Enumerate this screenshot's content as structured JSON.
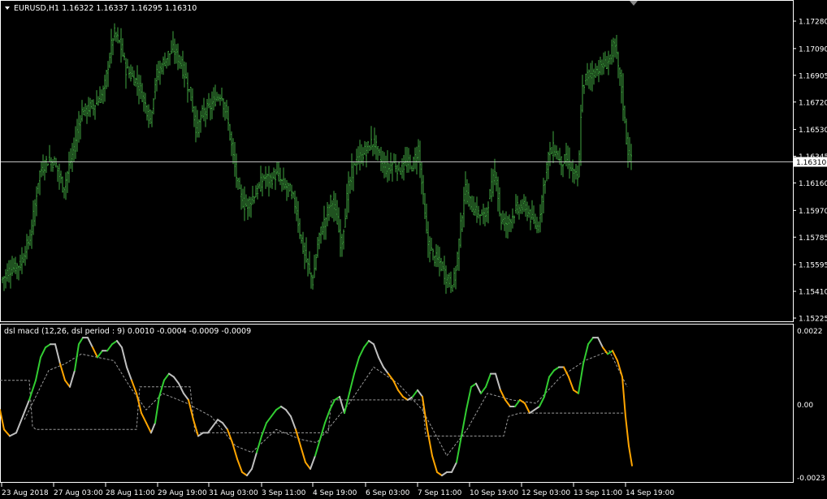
{
  "main": {
    "title": "EURUSD,H1  1.16322 1.16337 1.16295 1.16310",
    "current_price": "1.16310",
    "price_scale": [
      "1.17280",
      "1.17090",
      "1.16905",
      "1.16720",
      "1.16530",
      "1.16345",
      "1.16160",
      "1.15970",
      "1.15785",
      "1.15595",
      "1.15410",
      "1.15225"
    ]
  },
  "sub": {
    "title": "dsl macd (12,26, dsl period : 9) 0.0010 -0.0004 -0.0009 -0.0009",
    "scale_top": "0.0022",
    "scale_mid": "0.00",
    "scale_bottom": "-0.0023"
  },
  "time_axis": [
    "23 Aug 2018",
    "27 Aug 03:00",
    "28 Aug 11:00",
    "29 Aug 19:00",
    "31 Aug 03:00",
    "3 Sep 11:00",
    "4 Sep 19:00",
    "6 Sep 03:00",
    "7 Sep 11:00",
    "10 Sep 19:00",
    "12 Sep 03:00",
    "13 Sep 11:00",
    "14 Sep 19:00"
  ],
  "colors": {
    "background": "#000000",
    "bars": "#3fa53f",
    "macd_up": "#32cd32",
    "macd_neutral": "#c0c0c0",
    "macd_down": "#ffa500",
    "frame": "#ffffff",
    "signal": "#9a9a9a"
  },
  "chart_data": [
    {
      "type": "ohlc",
      "symbol": "EURUSD",
      "timeframe": "H1",
      "ylim": [
        1.15225,
        1.1737
      ],
      "current": 1.1631,
      "close_path": [
        [
          0,
          1.1548
        ],
        [
          12,
          1.1556
        ],
        [
          25,
          1.156
        ],
        [
          38,
          1.158
        ],
        [
          48,
          1.1622
        ],
        [
          58,
          1.1632
        ],
        [
          68,
          1.163
        ],
        [
          78,
          1.1612
        ],
        [
          90,
          1.1638
        ],
        [
          100,
          1.1665
        ],
        [
          110,
          1.1668
        ],
        [
          120,
          1.1672
        ],
        [
          128,
          1.168
        ],
        [
          135,
          1.1705
        ],
        [
          140,
          1.172
        ],
        [
          148,
          1.1712
        ],
        [
          155,
          1.1695
        ],
        [
          162,
          1.169
        ],
        [
          170,
          1.1685
        ],
        [
          178,
          1.1672
        ],
        [
          185,
          1.166
        ],
        [
          192,
          1.169
        ],
        [
          200,
          1.1698
        ],
        [
          207,
          1.1705
        ],
        [
          214,
          1.1708
        ],
        [
          222,
          1.17
        ],
        [
          228,
          1.169
        ],
        [
          235,
          1.1675
        ],
        [
          242,
          1.1652
        ],
        [
          250,
          1.1665
        ],
        [
          258,
          1.1668
        ],
        [
          266,
          1.1675
        ],
        [
          272,
          1.1678
        ],
        [
          280,
          1.166
        ],
        [
          288,
          1.163
        ],
        [
          295,
          1.1608
        ],
        [
          302,
          1.16
        ],
        [
          310,
          1.1605
        ],
        [
          318,
          1.1612
        ],
        [
          325,
          1.162
        ],
        [
          332,
          1.1618
        ],
        [
          340,
          1.1622
        ],
        [
          348,
          1.1615
        ],
        [
          356,
          1.1612
        ],
        [
          364,
          1.16
        ],
        [
          371,
          1.1575
        ],
        [
          378,
          1.156
        ],
        [
          385,
          1.1548
        ],
        [
          392,
          1.1578
        ],
        [
          400,
          1.159
        ],
        [
          408,
          1.1605
        ],
        [
          415,
          1.159
        ],
        [
          420,
          1.1572
        ],
        [
          428,
          1.161
        ],
        [
          436,
          1.163
        ],
        [
          445,
          1.1635
        ],
        [
          452,
          1.164
        ],
        [
          460,
          1.1645
        ],
        [
          468,
          1.1632
        ],
        [
          476,
          1.1625
        ],
        [
          484,
          1.163
        ],
        [
          492,
          1.1625
        ],
        [
          500,
          1.163
        ],
        [
          508,
          1.1628
        ],
        [
          515,
          1.164
        ],
        [
          520,
          1.161
        ],
        [
          526,
          1.1575
        ],
        [
          534,
          1.1565
        ],
        [
          542,
          1.156
        ],
        [
          550,
          1.155
        ],
        [
          558,
          1.1545
        ],
        [
          565,
          1.1575
        ],
        [
          572,
          1.1612
        ],
        [
          580,
          1.16
        ],
        [
          588,
          1.1595
        ],
        [
          596,
          1.1592
        ],
        [
          604,
          1.161
        ],
        [
          610,
          1.1625
        ],
        [
          616,
          1.159
        ],
        [
          624,
          1.1588
        ],
        [
          632,
          1.1595
        ],
        [
          640,
          1.16
        ],
        [
          648,
          1.1598
        ],
        [
          655,
          1.159
        ],
        [
          662,
          1.1585
        ],
        [
          668,
          1.161
        ],
        [
          675,
          1.1635
        ],
        [
          682,
          1.164
        ],
        [
          690,
          1.163
        ],
        [
          698,
          1.1632
        ],
        [
          706,
          1.1622
        ],
        [
          712,
          1.1618
        ],
        [
          716,
          1.168
        ],
        [
          722,
          1.169
        ],
        [
          730,
          1.1692
        ],
        [
          738,
          1.1696
        ],
        [
          746,
          1.1698
        ],
        [
          752,
          1.1705
        ],
        [
          756,
          1.1712
        ],
        [
          760,
          1.17
        ],
        [
          764,
          1.1685
        ],
        [
          768,
          1.1665
        ],
        [
          772,
          1.164
        ],
        [
          777,
          1.1631
        ]
      ]
    },
    {
      "type": "line",
      "name": "dsl macd",
      "ylim": [
        -0.0023,
        0.0022
      ],
      "macd_path": [
        [
          0,
          -0.0002
        ],
        [
          5,
          -0.0008
        ],
        [
          12,
          -0.001
        ],
        [
          20,
          -0.0009
        ],
        [
          28,
          -0.0004
        ],
        [
          36,
          0.0001
        ],
        [
          44,
          0.0007
        ],
        [
          50,
          0.0014
        ],
        [
          56,
          0.0017
        ],
        [
          62,
          0.0018
        ],
        [
          68,
          0.0018
        ],
        [
          74,
          0.0012
        ],
        [
          80,
          0.0007
        ],
        [
          86,
          0.0005
        ],
        [
          92,
          0.001
        ],
        [
          97,
          0.0018
        ],
        [
          102,
          0.002
        ],
        [
          108,
          0.002
        ],
        [
          114,
          0.0017
        ],
        [
          120,
          0.0014
        ],
        [
          126,
          0.0016
        ],
        [
          132,
          0.0016
        ],
        [
          138,
          0.0018
        ],
        [
          144,
          0.0019
        ],
        [
          150,
          0.0017
        ],
        [
          156,
          0.0011
        ],
        [
          162,
          0.0007
        ],
        [
          168,
          0.0003
        ],
        [
          174,
          -0.0003
        ],
        [
          180,
          -0.0006
        ],
        [
          186,
          -0.0009
        ],
        [
          191,
          -0.0006
        ],
        [
          196,
          0.0002
        ],
        [
          202,
          0.0007
        ],
        [
          208,
          0.0009
        ],
        [
          214,
          0.0008
        ],
        [
          220,
          0.0006
        ],
        [
          226,
          0.0003
        ],
        [
          232,
          0.0001
        ],
        [
          238,
          -0.0005
        ],
        [
          244,
          -0.001
        ],
        [
          250,
          -0.0009
        ],
        [
          256,
          -0.0009
        ],
        [
          262,
          -0.0007
        ],
        [
          268,
          -0.0005
        ],
        [
          274,
          -0.0006
        ],
        [
          280,
          -0.0008
        ],
        [
          286,
          -0.0012
        ],
        [
          292,
          -0.0017
        ],
        [
          298,
          -0.0021
        ],
        [
          304,
          -0.0022
        ],
        [
          310,
          -0.002
        ],
        [
          316,
          -0.0015
        ],
        [
          322,
          -0.001
        ],
        [
          328,
          -0.0006
        ],
        [
          334,
          -0.0004
        ],
        [
          340,
          -0.0002
        ],
        [
          346,
          -0.0001
        ],
        [
          352,
          -0.0002
        ],
        [
          358,
          -0.0004
        ],
        [
          364,
          -0.0008
        ],
        [
          370,
          -0.0013
        ],
        [
          376,
          -0.0018
        ],
        [
          382,
          -0.002
        ],
        [
          388,
          -0.0016
        ],
        [
          394,
          -0.0011
        ],
        [
          400,
          -0.0006
        ],
        [
          406,
          -0.0002
        ],
        [
          412,
          0.0001
        ],
        [
          418,
          0.0002
        ],
        [
          424,
          -0.0003
        ],
        [
          430,
          0.0003
        ],
        [
          436,
          0.0009
        ],
        [
          442,
          0.0014
        ],
        [
          448,
          0.0017
        ],
        [
          454,
          0.0019
        ],
        [
          460,
          0.0018
        ],
        [
          466,
          0.0014
        ],
        [
          472,
          0.0011
        ],
        [
          478,
          0.0009
        ],
        [
          484,
          0.0007
        ],
        [
          490,
          0.0004
        ],
        [
          496,
          0.0002
        ],
        [
          502,
          0.0001
        ],
        [
          508,
          0.0002
        ],
        [
          514,
          0.0004
        ],
        [
          520,
          0.0002
        ],
        [
          526,
          -0.0008
        ],
        [
          532,
          -0.0016
        ],
        [
          538,
          -0.0021
        ],
        [
          544,
          -0.0022
        ],
        [
          550,
          -0.0021
        ],
        [
          556,
          -0.0021
        ],
        [
          562,
          -0.0018
        ],
        [
          568,
          -0.001
        ],
        [
          574,
          -0.0002
        ],
        [
          580,
          0.0005
        ],
        [
          586,
          0.0006
        ],
        [
          592,
          0.0003
        ],
        [
          598,
          0.0005
        ],
        [
          604,
          0.0009
        ],
        [
          610,
          0.0009
        ],
        [
          616,
          0.0004
        ],
        [
          622,
          0.0001
        ],
        [
          628,
          -0.0001
        ],
        [
          634,
          -0.0001
        ],
        [
          640,
          0.0001
        ],
        [
          646,
          0.0
        ],
        [
          652,
          -0.0003
        ],
        [
          658,
          -0.0002
        ],
        [
          664,
          -0.0001
        ],
        [
          670,
          0.0002
        ],
        [
          676,
          0.0008
        ],
        [
          682,
          0.001
        ],
        [
          688,
          0.0011
        ],
        [
          694,
          0.0011
        ],
        [
          700,
          0.0008
        ],
        [
          706,
          0.0004
        ],
        [
          712,
          0.0003
        ],
        [
          718,
          0.0012
        ],
        [
          724,
          0.0018
        ],
        [
          730,
          0.002
        ],
        [
          736,
          0.002
        ],
        [
          742,
          0.0017
        ],
        [
          748,
          0.0015
        ],
        [
          754,
          0.0016
        ],
        [
          760,
          0.0013
        ],
        [
          766,
          0.0008
        ],
        [
          770,
          -0.0004
        ],
        [
          774,
          -0.0013
        ],
        [
          778,
          -0.0019
        ]
      ],
      "signal_path": [
        [
          0,
          0.0007
        ],
        [
          36,
          0.0007
        ],
        [
          40,
          -0.0007
        ],
        [
          44,
          -0.0008
        ],
        [
          168,
          -0.0008
        ],
        [
          172,
          0.0005
        ],
        [
          176,
          0.0005
        ],
        [
          234,
          0.0005
        ],
        [
          240,
          -0.0009
        ],
        [
          404,
          -0.0009
        ],
        [
          408,
          0.0001
        ],
        [
          412,
          0.0001
        ],
        [
          520,
          0.0001
        ],
        [
          524,
          -0.001
        ],
        [
          528,
          -0.001
        ],
        [
          620,
          -0.001
        ],
        [
          626,
          -0.0004
        ],
        [
          640,
          -0.0003
        ],
        [
          660,
          -0.0003
        ],
        [
          664,
          -0.0003
        ],
        [
          770,
          -0.0003
        ]
      ],
      "signal_path2": [
        [
          30,
          -0.0005
        ],
        [
          60,
          0.001
        ],
        [
          80,
          0.0012
        ],
        [
          100,
          0.0015
        ],
        [
          140,
          0.0013
        ],
        [
          160,
          0.0005
        ],
        [
          180,
          -0.0002
        ],
        [
          200,
          0.0003
        ],
        [
          230,
          0.0
        ],
        [
          260,
          -0.0004
        ],
        [
          290,
          -0.0013
        ],
        [
          310,
          -0.0015
        ],
        [
          340,
          -0.0008
        ],
        [
          370,
          -0.0011
        ],
        [
          390,
          -0.0012
        ],
        [
          410,
          -0.0006
        ],
        [
          430,
          0.0
        ],
        [
          460,
          0.0011
        ],
        [
          490,
          0.0006
        ],
        [
          520,
          -0.0002
        ],
        [
          550,
          -0.0016
        ],
        [
          575,
          -0.0008
        ],
        [
          600,
          0.0003
        ],
        [
          630,
          0.0001
        ],
        [
          660,
          0.0
        ],
        [
          690,
          0.0008
        ],
        [
          720,
          0.0013
        ],
        [
          750,
          0.0016
        ],
        [
          772,
          0.0005
        ]
      ]
    }
  ]
}
